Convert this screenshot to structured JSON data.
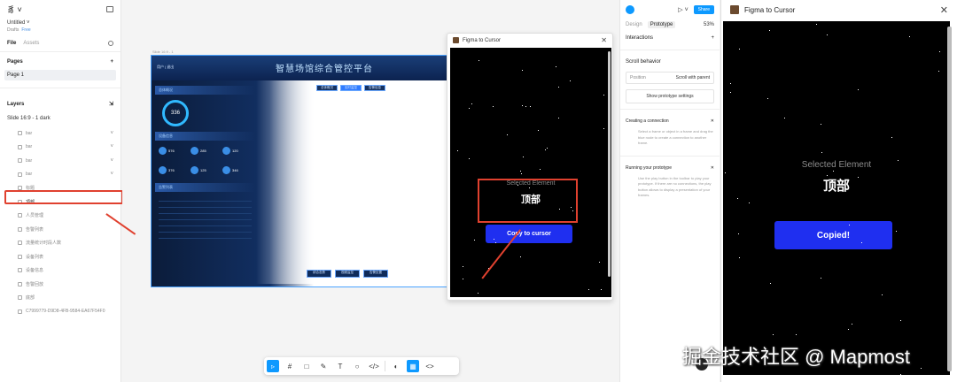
{
  "left_panel": {
    "logo": "豸 ˅",
    "file_name": "Untitled ˅",
    "drafts": "Drafts",
    "plan": "Free",
    "tabs": [
      "File",
      "Assets"
    ],
    "pages_title": "Pages",
    "current_page": "Page 1",
    "layers_title": "Layers",
    "frame": "Slide 16:9 - 1  dark",
    "layers": [
      "bar",
      "bar",
      "bar",
      "bar",
      "标题",
      "顶部",
      "人员管理",
      "告警列表",
      "流量统计时段人数",
      "设备列表",
      "设备信息",
      "告警回放",
      "底部",
      "C7999779-D9D8-4FB-9584-EA67F54F0"
    ],
    "highlighted_layer": "顶部"
  },
  "canvas": {
    "frame_label": "Slide 16:9 - 1",
    "dashboard_title": "智慧场馆综合管控平台",
    "dashboard_user": "用户  |  退出",
    "gauge_value": "336",
    "sections": [
      "总体概况",
      "设备信息",
      "告警列表"
    ],
    "kpis": [
      "576",
      "285",
      "120",
      "376",
      "125",
      "346"
    ],
    "top_tabs": [
      "总体概况",
      "实时监控",
      "告警信息"
    ],
    "bottom_tabs": [
      "综合态势",
      "视频监控",
      "告警处置"
    ],
    "plugin_title": "Figma to Cursor",
    "selected_label": "Selected Element",
    "selected_name": "顶部",
    "copy_button": "Copy to cursor"
  },
  "toolbar": {
    "tools": [
      "▹",
      "#",
      "□",
      "✎",
      "T",
      "○",
      "</>",
      "◐",
      "▦",
      "<>"
    ]
  },
  "right_panel": {
    "share": "Share",
    "tabs": [
      "Design",
      "Prototype"
    ],
    "zoom": "53%",
    "interactions": "Interactions",
    "scroll_behavior": "Scroll behavior",
    "position_label": "Position",
    "position_value": "Scroll with parent",
    "show_settings": "Show prototype settings",
    "creating_title": "Creating a connection",
    "creating_text": "Select a frame or object in a frame and drag the blue node to create a connection to another frame.",
    "running_title": "Running your prototype",
    "running_text": "Use the play button in the toolbar to play your prototype. If there are no connections, the play button allows to display a presentation of your frames."
  },
  "plugin_window": {
    "title": "Figma to Cursor",
    "selected_label": "Selected Element",
    "selected_name": "顶部",
    "button": "Copied!"
  },
  "watermark": "掘金技术社区 @ Mapmost",
  "colors": {
    "accent": "#0d99ff",
    "plugin_button": "#1f2ff0",
    "highlight": "#e0412f"
  }
}
